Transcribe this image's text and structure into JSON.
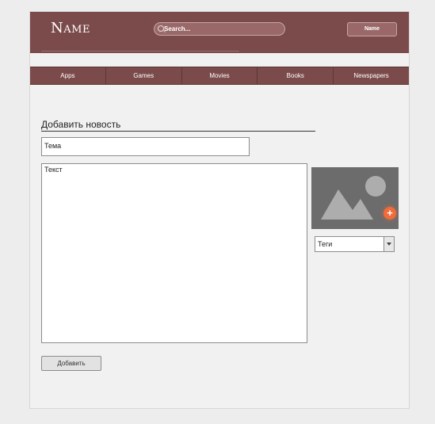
{
  "header": {
    "logo": "Name",
    "search_placeholder": "Search...",
    "user_button": "Name"
  },
  "nav": [
    "Apps",
    "Games",
    "Movies",
    "Books",
    "Newspapers"
  ],
  "form": {
    "title": "Добавить новость",
    "topic_placeholder": "Тема",
    "text_placeholder": "Текст",
    "tags_selected": "Теги",
    "submit_label": "Добавить"
  },
  "icons": {
    "image": "image-placeholder-icon",
    "add_image": "plus-icon",
    "search": "search-icon",
    "dropdown": "chevron-down-icon"
  },
  "colors": {
    "brand": "#7b4a4a",
    "accent": "#f26b3a",
    "page_bg": "#f1f1f1"
  }
}
